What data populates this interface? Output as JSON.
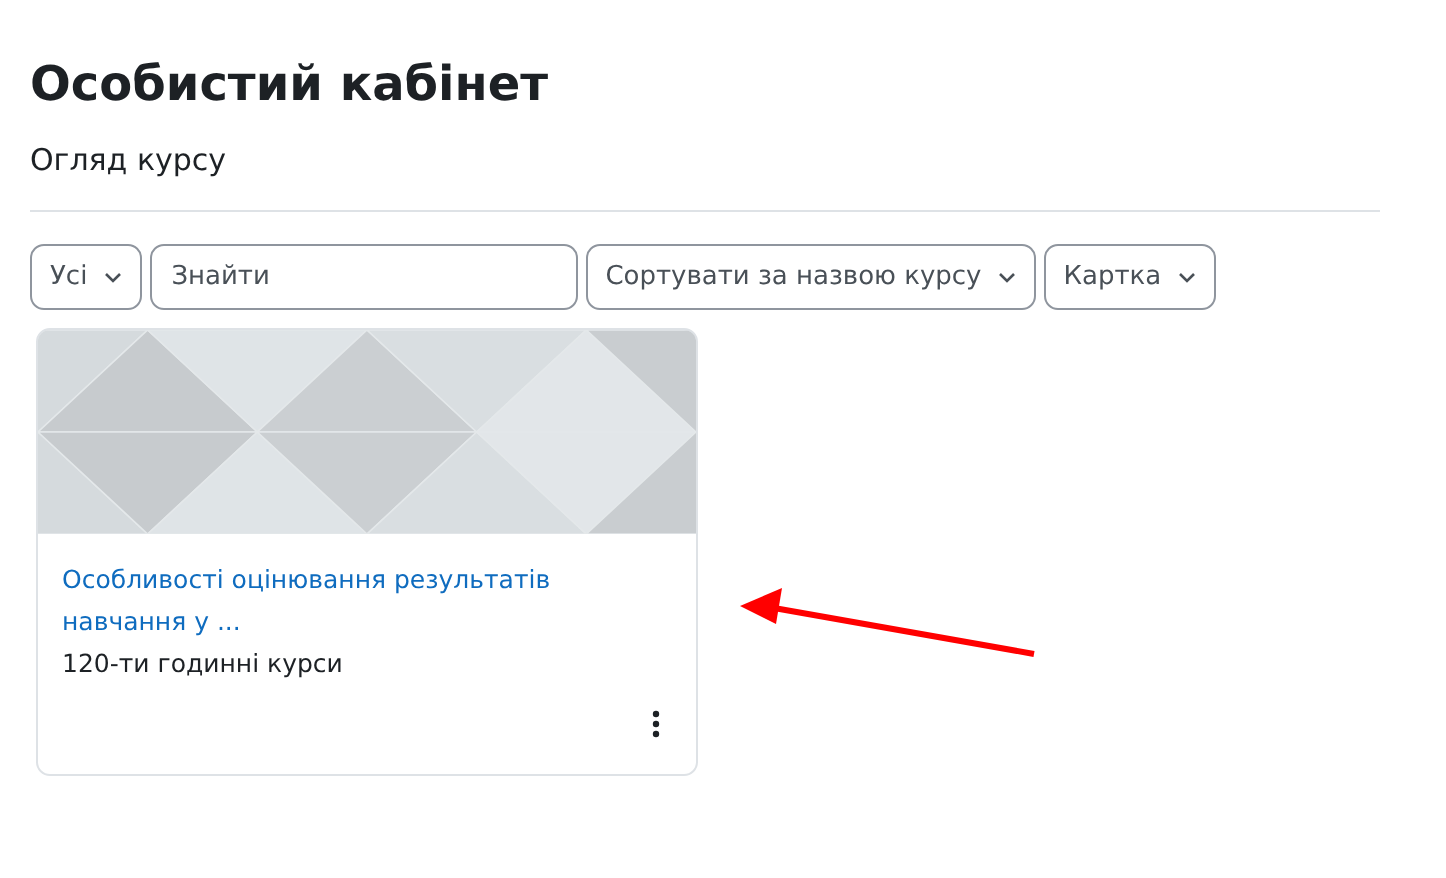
{
  "page_title": "Особистий кабінет",
  "section_title": "Огляд курсу",
  "filters": [
    {
      "kind": "dropdown",
      "label": "Усі"
    },
    {
      "kind": "search",
      "placeholder": "Знайти"
    },
    {
      "kind": "dropdown",
      "label": "Сортувати за назвою курсу"
    },
    {
      "kind": "dropdown",
      "label": "Картка"
    }
  ],
  "courses": [
    {
      "title": "Особливості оцінювання результатів навчання у ...",
      "category": "120-ти годинні курси"
    }
  ]
}
